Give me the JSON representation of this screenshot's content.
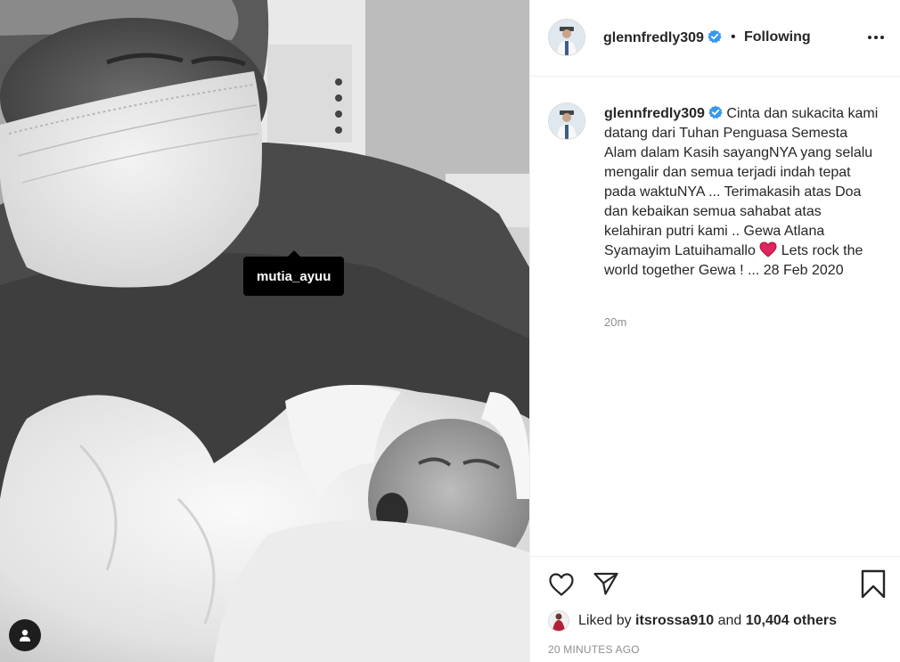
{
  "photo": {
    "tag_username": "mutia_ayuu",
    "tag_icon": "user-icon"
  },
  "post": {
    "username": "glennfredly309",
    "verified_icon": "verified-badge-icon",
    "separator": "•",
    "follow_status": "Following",
    "more_icon": "more-options-icon"
  },
  "caption": {
    "username": "glennfredly309",
    "text_before_emoji": "Cinta dan sukacita kami datang dari Tuhan Penguasa Semesta Alam dalam Kasih sayangNYA yang selalu mengalir dan semua terjadi indah tepat pada waktuNYA ... Terimakasih atas Doa dan kebaikan semua sahabat atas kelahiran putri kami .. Gewa Atlana Syamayim Latuihamallo",
    "emoji": "red-heart-icon",
    "text_after_emoji": "Lets rock the world together Gewa ! ... 28 Feb 2020",
    "time": "20m"
  },
  "actions": {
    "like_icon": "heart-outline-icon",
    "share_icon": "send-icon",
    "save_icon": "bookmark-icon"
  },
  "likes": {
    "prefix": "Liked by",
    "user": "itsrossa910",
    "conjunction": "and",
    "others": "10,404 others"
  },
  "timestamp": "20 MINUTES AGO",
  "colors": {
    "verified": "#3897f0",
    "text": "#262626",
    "muted": "#8e8e8e",
    "heart": "#e0245e"
  }
}
